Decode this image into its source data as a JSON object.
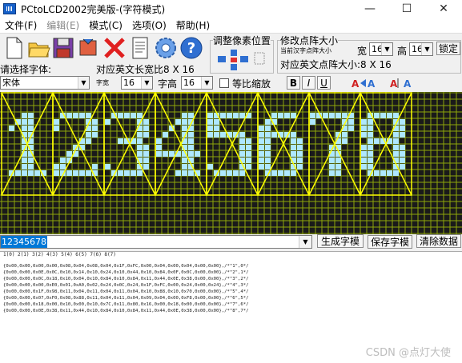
{
  "window": {
    "title": "PCtoLCD2002完美版-(字符模式)",
    "min_glyph": "—",
    "max_glyph": "☐",
    "close_glyph": "✕"
  },
  "menu": [
    {
      "label": "文件(F)",
      "enabled": true
    },
    {
      "label": "编辑(E)",
      "enabled": false
    },
    {
      "label": "模式(C)",
      "enabled": true
    },
    {
      "label": "选项(O)",
      "enabled": true
    },
    {
      "label": "帮助(H)",
      "enabled": true
    }
  ],
  "toolbar": {
    "tools": [
      "new-file-icon",
      "open-folder-icon",
      "save-disk-icon",
      "delete-icon",
      "document-icon",
      "settings-gear-icon",
      "help-icon"
    ],
    "adjust_pixel_label": "调整像素位置",
    "modify_matrix_label": "修改点阵大小",
    "current_char_size_label": "当前汉字点阵大小",
    "width_label": "宽",
    "width_value": "16",
    "height_label": "高",
    "height_value": "16",
    "lock_label": "锁定",
    "en_size_label": "对应英文点阵大小:8 X 16",
    "en_size_label_left": "对应英文长宽比8 X 16"
  },
  "font_row": {
    "choose_font_label": "请选择字体:",
    "font_value": "宋体",
    "char_width_label": "字宽",
    "char_width_value": "16",
    "char_height_label": "字高",
    "char_height_value": "16",
    "proportional_label": "等比缩放",
    "bold_label": "B",
    "italic_label": "I",
    "underline_label": "U"
  },
  "lcd": {
    "grid_color": "#8fa60b",
    "pixel_on_color": "#aee8ff",
    "frame_color": "#ffff00",
    "glyphs": [
      [
        "...XX...",
        "..XXX...",
        ".X.XX...",
        "...XX...",
        "...XX...",
        "...XX...",
        "...XX...",
        "...XX...",
        "...XX...",
        ".XXXXXX."
      ],
      [
        ".XXXXX..",
        "X....XX.",
        "X....XX.",
        ".....XX.",
        "....XX..",
        "...XX...",
        "..XX....",
        ".XX.....",
        "XX....X.",
        "XXXXXXX."
      ],
      [
        ".XXXXX..",
        "X....XX.",
        ".....XX.",
        ".....XX.",
        "..XXXX..",
        ".....XX.",
        ".....XX.",
        ".....XX.",
        "X....XX.",
        ".XXXXX.."
      ],
      [
        "....XX..",
        "...XXX..",
        "..X.XX..",
        ".X..XX..",
        "X...XX..",
        "X...XX..",
        "XXXXXXX.",
        "....XX..",
        "....XX..",
        "...XXXX."
      ],
      [
        "XXXXXXX.",
        "XX......",
        "XX......",
        "XXXXXX..",
        ".....XX.",
        ".....XX.",
        ".....XX.",
        ".....XX.",
        "X....XX.",
        ".XXXXX.."
      ],
      [
        "..XXXX..",
        ".XX.....",
        "XX......",
        "XXXXXX..",
        "XX...XX.",
        "XX...XX.",
        "XX...XX.",
        "XX...XX.",
        "XX...XX.",
        ".XXXXX.."
      ],
      [
        "XXXXXXX.",
        "X....XX.",
        ".....XX.",
        "....XX..",
        "....XX..",
        "...XX...",
        "...XX...",
        "...XX...",
        "...XX...",
        "...XX..."
      ],
      [
        ".XXXXX..",
        "XX...XX.",
        "XX...XX.",
        "XX...XX.",
        ".XXXXX..",
        "XX...XX.",
        "XX...XX.",
        "XX...XX.",
        "XX...XX.",
        ".XXXXX.."
      ]
    ]
  },
  "text_row": {
    "input_value": "12345678",
    "generate_label": "生成字模",
    "save_label": "保存字模",
    "clear_label": "清除数据"
  },
  "output": {
    "header": " 1(0)  2(1)  3(2)  4(3)  5(4)  6(5)  7(6)  8(7)",
    "lines": [
      "{0x00,0x00,0x00,0x00,0x08,0x04,0x08,0x04,0x1F,0xFC,0x00,0x04,0x00,0x04,0x00,0x00},/*\"1\",0*/",
      "{0x00,0x00,0x0E,0x0C,0x10,0x14,0x10,0x24,0x10,0x44,0x10,0x84,0x0F,0x0C,0x00,0x00},/*\"2\",1*/",
      "{0x00,0x00,0x0C,0x18,0x10,0x04,0x10,0x84,0x10,0x84,0x11,0x44,0x0E,0x38,0x00,0x00},/*\"3\",2*/",
      "{0x00,0x00,0x00,0xE0,0x01,0xA0,0x02,0x24,0x0C,0x24,0x1F,0xFC,0x00,0x24,0x00,0x24},/*\"4\",3*/",
      "{0x00,0x00,0x1F,0x98,0x11,0x04,0x11,0x04,0x11,0x04,0x10,0x88,0x10,0x70,0x00,0x00},/*\"5\",4*/",
      "{0x00,0x00,0x07,0xF0,0x08,0x88,0x11,0x04,0x11,0x04,0x09,0x04,0x00,0xF8,0x00,0x00},/*\"6\",5*/",
      "{0x00,0x00,0x18,0x00,0x10,0x00,0x10,0x7C,0x11,0x80,0x16,0x00,0x18,0x00,0x00,0x00},/*\"7\",6*/",
      "{0x00,0x00,0x0E,0x38,0x11,0x44,0x10,0x84,0x10,0x84,0x11,0x44,0x0E,0x38,0x00,0x00},/*\"8\",7*/"
    ],
    "watermark": "CSDN @点灯大使"
  }
}
